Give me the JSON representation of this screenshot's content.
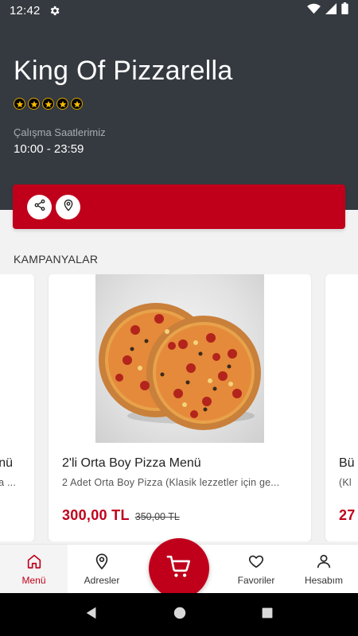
{
  "status": {
    "time": "12:42"
  },
  "shop": {
    "title": "King Of Pizzarella",
    "rating_stars": 5,
    "hours_label": "Çalışma Saatlerimiz",
    "hours_value": "10:00 - 23:59"
  },
  "section": {
    "title": "KAMPANYALAR"
  },
  "campaigns": [
    {
      "name": "nü",
      "desc": "a ...",
      "price": ""
    },
    {
      "name": "2'li Orta Boy Pizza Menü",
      "desc": "2 Adet Orta Boy Pizza (Klasik lezzetler için ge...",
      "price": "300,00 TL",
      "old_price": "350,00 TL"
    },
    {
      "name": "Bü",
      "desc": "(Kl",
      "price": "27"
    }
  ],
  "nav": {
    "menu": "Menü",
    "adresler": "Adresler",
    "favoriler": "Favoriler",
    "hesabim": "Hesabım"
  },
  "colors": {
    "brand": "#c0001b",
    "header": "#353a40"
  }
}
